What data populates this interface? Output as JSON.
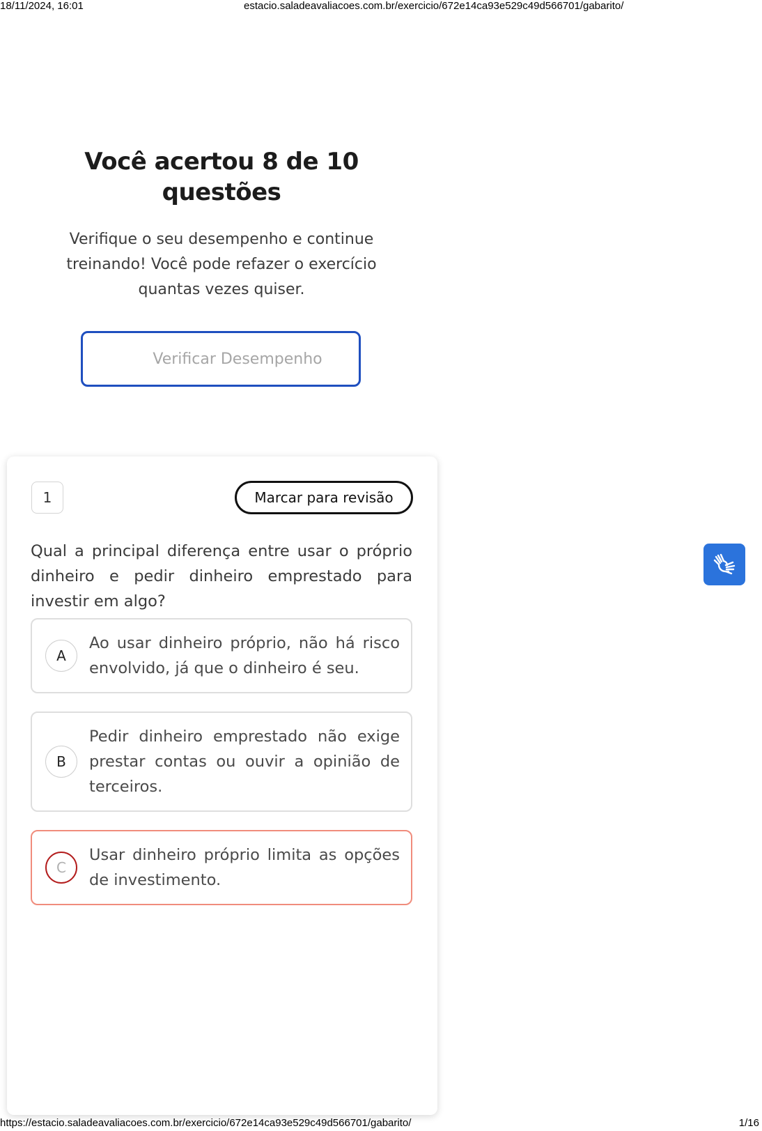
{
  "print": {
    "datetime": "18/11/2024, 16:01",
    "header_url": "estacio.saladeavaliacoes.com.br/exercicio/672e14ca93e529c49d566701/gabarito/",
    "footer_url": "https://estacio.saladeavaliacoes.com.br/exercicio/672e14ca93e529c49d566701/gabarito/",
    "page_counter": "1/16"
  },
  "result": {
    "title": "Você acertou 8 de 10 questões",
    "subtitle": "Verifique o seu desempenho e continue treinando! Você pode refazer o exercício quantas vezes quiser.",
    "verify_button": "Verificar Desempenho"
  },
  "question": {
    "number": "1",
    "review_button": "Marcar para revisão",
    "text": "Qual a principal diferença entre usar o próprio dinheiro e pedir dinheiro emprestado para investir em algo?",
    "options": [
      {
        "letter": "A",
        "text": "Ao usar dinheiro próprio, não há risco envolvido, já que o dinheiro é seu.",
        "state": "neutral"
      },
      {
        "letter": "B",
        "text": "Pedir dinheiro emprestado não exige prestar contas ou ouvir a opinião de terceiros.",
        "state": "neutral"
      },
      {
        "letter": "C",
        "text": "Usar dinheiro próprio limita as opções de investimento.",
        "state": "incorrect"
      }
    ]
  },
  "accessibility": {
    "icon": "sign-language-icon",
    "color": "#2b73dc"
  },
  "colors": {
    "primary_border": "#1f4fbf",
    "incorrect_border": "#f08c7c",
    "incorrect_letter_ring": "#b31d1d"
  }
}
